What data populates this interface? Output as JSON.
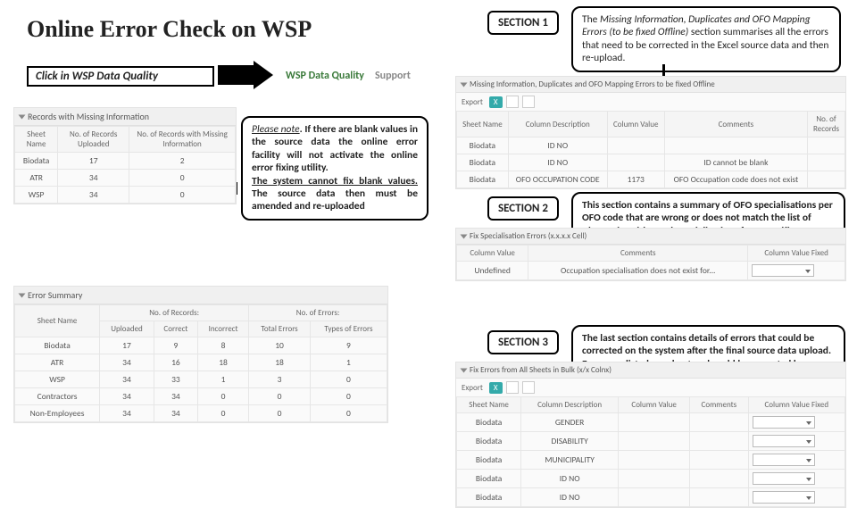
{
  "title": "Online Error Check on WSP",
  "click_label": "Click in WSP Data Quality",
  "tabs": {
    "active": "WSP Data Quality",
    "other": "Support"
  },
  "section1": {
    "label": "SECTION 1"
  },
  "section2": {
    "label": "SECTION 2"
  },
  "section3": {
    "label": "SECTION 3"
  },
  "callout_top_right_a": "The ",
  "callout_top_right_b": "Missing Information, Duplicates and OFO Mapping Errors (to be fixed Offline)",
  "callout_top_right_c": " section summarises all the errors that need to be corrected in the Excel source data and then re-upload.",
  "callout_pn_1": "Please note",
  "callout_pn_2": ". If there are blank values in the source data the online error facility will not activate the online error fixing utility.",
  "callout_pn_3": "The system cannot fix blank values.",
  "callout_pn_4": " The source data then must be amended and re-uploaded",
  "callout_s2": "This section contains a summary of OFO specialisations per OFO code that are wrong or does not match the list of Alternative Titles and Specialisations for a specific OFO Code. These errors could be corrected online",
  "callout_s3": "The last section contains details of errors that could be corrected on the system after the final source data upload. Errors are listed per sheet and could be corrected by selecting the appropriate value from the dropdown list for each field on the respective sheets",
  "left_panel1": {
    "title": "Records with Missing Information",
    "headers": [
      "Sheet Name",
      "No. of Records Uploaded",
      "No. of Records with Missing Information"
    ],
    "rows": [
      [
        "Biodata",
        "17",
        "2"
      ],
      [
        "ATR",
        "34",
        "0"
      ],
      [
        "WSP",
        "34",
        "0"
      ]
    ]
  },
  "left_panel2": {
    "title": "Error Summary",
    "headers": [
      "Sheet Name",
      "Uploaded",
      "Correct",
      "Incorrect",
      "Total Errors",
      "Types of Errors"
    ],
    "group1": "No. of Records:",
    "group2": "No. of Errors:",
    "rows": [
      [
        "Biodata",
        "17",
        "9",
        "8",
        "10",
        "9"
      ],
      [
        "ATR",
        "34",
        "16",
        "18",
        "18",
        "1"
      ],
      [
        "WSP",
        "34",
        "33",
        "1",
        "3",
        "0"
      ],
      [
        "Contractors",
        "34",
        "34",
        "0",
        "0",
        "0"
      ],
      [
        "Non-Employees",
        "34",
        "34",
        "0",
        "0",
        "0"
      ]
    ]
  },
  "right_panel1": {
    "title": "Missing Information, Duplicates and OFO Mapping Errors to be fixed Offline",
    "export": "Export",
    "headers": [
      "Sheet Name",
      "Column Description",
      "Column Value",
      "Comments",
      "No. of Records"
    ],
    "rows": [
      [
        "Biodata",
        "ID NO",
        "",
        "",
        ""
      ],
      [
        "Biodata",
        "ID NO",
        "",
        "ID cannot be blank",
        ""
      ],
      [
        "Biodata",
        "OFO OCCUPATION CODE",
        "1173",
        "OFO Occupation code does not exist",
        ""
      ]
    ]
  },
  "right_panel2": {
    "title": "Fix Specialisation Errors (x.x.x.x Cell)",
    "headers": [
      "Column Value",
      "Comments",
      "Column Value Fixed"
    ],
    "rows": [
      [
        "Undefined",
        "Occupation specialisation does not exist for...",
        ""
      ]
    ]
  },
  "right_panel3": {
    "title": "Fix Errors from All Sheets in Bulk (x/x Colnx)",
    "export": "Export",
    "headers": [
      "Sheet Name",
      "Column Description",
      "Column Value",
      "Comments",
      "Column Value Fixed"
    ],
    "rows": [
      [
        "Biodata",
        "GENDER",
        "",
        "",
        ""
      ],
      [
        "Biodata",
        "DISABILITY",
        "",
        "",
        ""
      ],
      [
        "Biodata",
        "MUNICIPALITY",
        "",
        "",
        ""
      ],
      [
        "Biodata",
        "ID NO",
        "",
        "",
        ""
      ],
      [
        "Biodata",
        "ID NO",
        "",
        "",
        ""
      ]
    ]
  }
}
